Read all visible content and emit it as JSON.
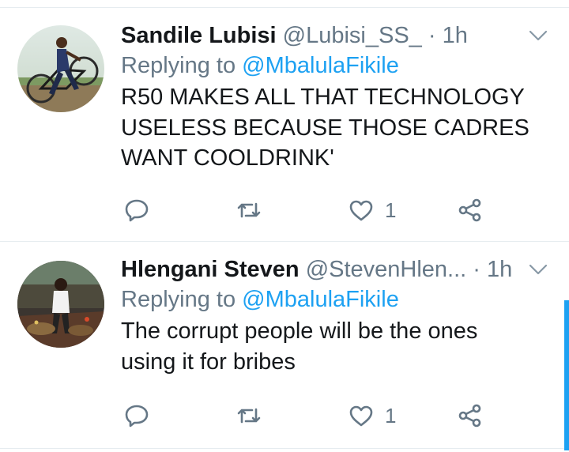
{
  "tweets": [
    {
      "name": "Sandile Lubisi",
      "handle": "@Lubisi_SS_",
      "separator": "·",
      "time": "1h",
      "reply_prefix": "Replying to",
      "reply_to": "@MbalulaFikile",
      "text_lines": [
        "R50 MAKES ALL THAT TECHNOLOGY",
        "USELESS BECAUSE THOSE CADRES",
        "WANT COOLDRINK'"
      ],
      "like_count": "1",
      "icons": [
        "reply-icon",
        "retweet-icon",
        "heart-icon",
        "share-icon",
        "chevron-down-icon"
      ]
    },
    {
      "name": "Hlengani Steven",
      "handle": "@StevenHlen...",
      "separator": "·",
      "time": "1h",
      "reply_prefix": "Replying to",
      "reply_to": "@MbalulaFikile",
      "text_lines": [
        "The corrupt people will be the ones",
        "using it for bribes"
      ],
      "like_count": "1",
      "icons": [
        "reply-icon",
        "retweet-icon",
        "heart-icon",
        "share-icon",
        "chevron-down-icon"
      ]
    }
  ],
  "colors": {
    "text": "#14171a",
    "secondary": "#657786",
    "link": "#1da1f2",
    "divider": "#e6ecf0"
  }
}
